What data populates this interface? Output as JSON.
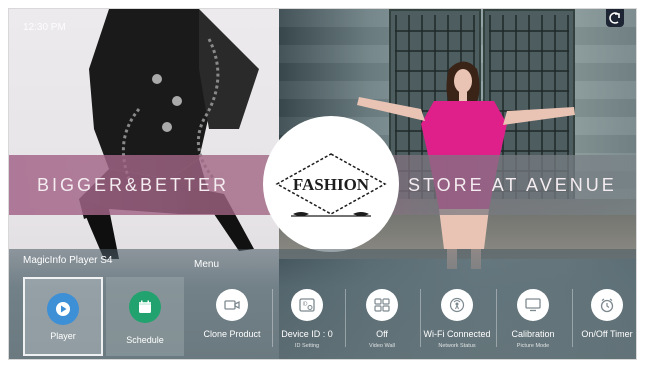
{
  "screen": {
    "time": "12:30 PM"
  },
  "banner": {
    "left_text": "BIGGER&BETTER",
    "logo_text": "FASHION",
    "right_text": "STORE AT AVENUE"
  },
  "menu": {
    "player_title": "MagicInfo Player S4",
    "title": "Menu",
    "items": [
      {
        "label": "Player",
        "sub": "",
        "icon": "play-icon",
        "focused": true
      },
      {
        "label": "Schedule",
        "sub": "",
        "icon": "calendar-icon"
      },
      {
        "label": "Clone Product",
        "sub": "",
        "icon": "clone-icon"
      },
      {
        "label": "Device ID : 0",
        "sub": "ID Setting",
        "icon": "device-id-icon"
      },
      {
        "label": "Off",
        "sub": "Video Wall",
        "icon": "video-wall-icon"
      },
      {
        "label": "Wi-Fi Connected",
        "sub": "Network Status",
        "icon": "network-icon"
      },
      {
        "label": "Calibration",
        "sub": "Picture Mode",
        "icon": "monitor-icon"
      },
      {
        "label": "On/Off Timer",
        "sub": "",
        "icon": "clock-icon"
      }
    ]
  },
  "colors": {
    "accent_blue": "#3d8fd6",
    "accent_green": "#22a26e",
    "banner_pink": "#a4668a"
  }
}
